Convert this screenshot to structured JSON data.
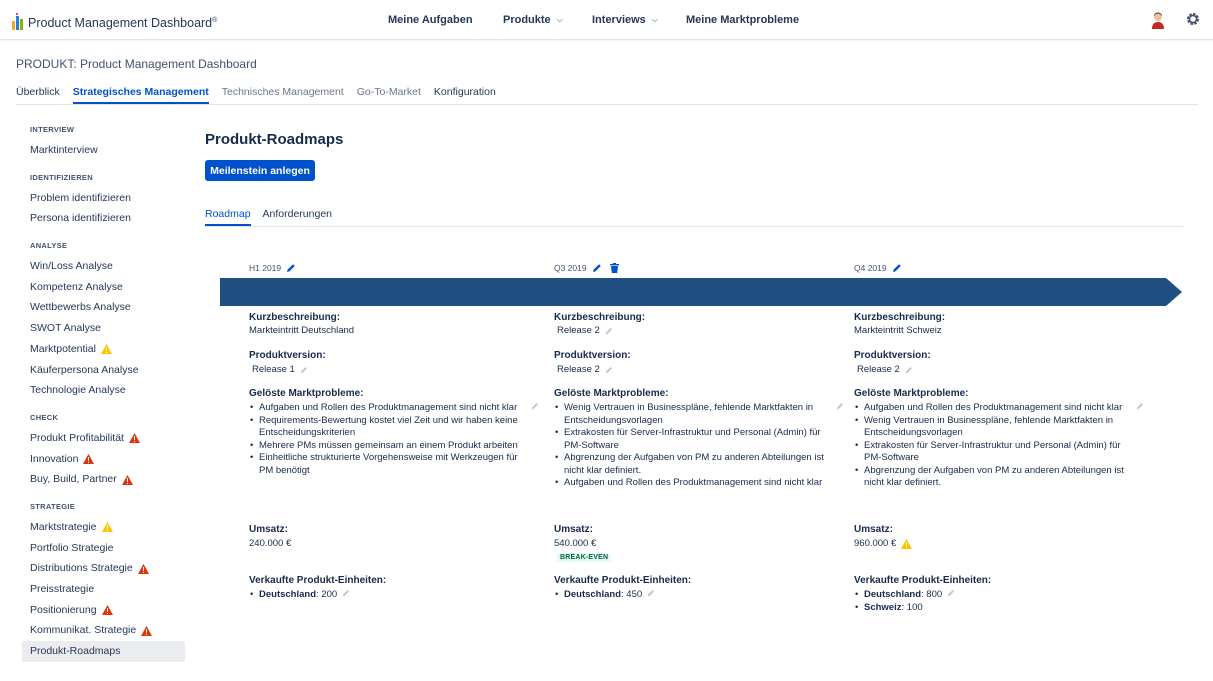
{
  "app": {
    "title": "Product Management Dashboard",
    "trademark": "®"
  },
  "topnav": [
    {
      "label": "Meine Aufgaben",
      "dropdown": false
    },
    {
      "label": "Produkte",
      "dropdown": true
    },
    {
      "label": "Interviews",
      "dropdown": true
    },
    {
      "label": "Meine Marktprobleme",
      "dropdown": false
    }
  ],
  "header": {
    "product_title": "PRODUKT: Product Management Dashboard",
    "tabs": [
      {
        "label": "Überblick",
        "state": "dark"
      },
      {
        "label": "Strategisches Management",
        "state": "active"
      },
      {
        "label": "Technisches Management",
        "state": "muted"
      },
      {
        "label": "Go-To-Market",
        "state": "muted"
      },
      {
        "label": "Konfiguration",
        "state": "dark"
      }
    ]
  },
  "sidebar": {
    "sections": [
      {
        "title": "INTERVIEW",
        "items": [
          {
            "label": "Marktinterview",
            "warning": null
          }
        ]
      },
      {
        "title": "IDENTIFIZIEREN",
        "items": [
          {
            "label": "Problem identifizieren",
            "warning": null
          },
          {
            "label": "Persona identifizieren",
            "warning": null
          }
        ]
      },
      {
        "title": "ANALYSE",
        "items": [
          {
            "label": "Win/Loss Analyse",
            "warning": null
          },
          {
            "label": "Kompetenz Analyse",
            "warning": null
          },
          {
            "label": "Wettbewerbs Analyse",
            "warning": null
          },
          {
            "label": "SWOT Analyse",
            "warning": null
          },
          {
            "label": "Marktpotential",
            "warning": "yellow"
          },
          {
            "label": "Käuferpersona Analyse",
            "warning": null
          },
          {
            "label": "Technologie Analyse",
            "warning": null
          }
        ]
      },
      {
        "title": "CHECK",
        "items": [
          {
            "label": "Produkt Profitabilität",
            "warning": "red"
          },
          {
            "label": "Innovation",
            "warning": "red"
          },
          {
            "label": "Buy, Build, Partner",
            "warning": "red"
          }
        ]
      },
      {
        "title": "STRATEGIE",
        "items": [
          {
            "label": "Marktstrategie",
            "warning": "yellow"
          },
          {
            "label": "Portfolio Strategie",
            "warning": null
          },
          {
            "label": "Distributions Strategie",
            "warning": "red"
          },
          {
            "label": "Preisstrategie",
            "warning": null
          },
          {
            "label": "Positionierung",
            "warning": "red"
          },
          {
            "label": "Kommunikat. Strategie",
            "warning": "red"
          },
          {
            "label": "Produkt-Roadmaps",
            "warning": null,
            "active": true
          }
        ]
      }
    ]
  },
  "main": {
    "title": "Produkt-Roadmaps",
    "primary_button": "Meilenstein anlegen",
    "subtabs": [
      {
        "label": "Roadmap",
        "active": true
      },
      {
        "label": "Anforderungen",
        "active": false
      }
    ],
    "labels": {
      "kurz": "Kurzbeschreibung:",
      "version": "Produktversion:",
      "probleme": "Gelöste Marktprobleme:",
      "umsatz": "Umsatz:",
      "einheiten": "Verkaufte Produkt-Einheiten:"
    },
    "milestones": [
      {
        "period": "H1 2019",
        "icons": [
          "pencil-icon"
        ],
        "kurzbeschreibung": "Markteintritt Deutschland",
        "kurz_editable": false,
        "produktversion": "Release 1",
        "probleme": [
          "Aufgaben und Rollen des Produktmanagement sind nicht klar",
          "Requirements-Bewertung kostet viel Zeit und wir haben keine Entscheidungskriterien",
          "Mehrere PMs müssen gemeinsam an einem Produkt arbeiten",
          "Einheitliche strukturierte Vorgehensweise mit Werkzeugen für PM benötigt"
        ],
        "umsatz": "240.000 €",
        "umsatz_badge": null,
        "umsatz_warning": null,
        "einheiten": [
          {
            "country": "Deutschland",
            "count": "200"
          }
        ]
      },
      {
        "period": "Q3 2019",
        "icons": [
          "pencil-icon",
          "trash-icon"
        ],
        "kurzbeschreibung": "Release 2",
        "kurz_editable": true,
        "produktversion": "Release 2",
        "probleme": [
          "Wenig Vertrauen in Businesspläne, fehlende Marktfakten in Entscheidungsvorlagen",
          "Extrakosten für Server-Infrastruktur und Personal (Admin) für PM-Software",
          "Abgrenzung der Aufgaben von PM zu anderen Abteilungen ist nicht klar definiert.",
          "Aufgaben und Rollen des Produktmanagement sind nicht klar"
        ],
        "umsatz": "540.000 €",
        "umsatz_badge": "BREAK-EVEN",
        "umsatz_warning": null,
        "einheiten": [
          {
            "country": "Deutschland",
            "count": "450"
          }
        ]
      },
      {
        "period": "Q4 2019",
        "icons": [
          "pencil-icon"
        ],
        "kurzbeschreibung": "Markteintritt Schweiz",
        "kurz_editable": false,
        "produktversion": "Release 2",
        "probleme": [
          "Aufgaben und Rollen des Produktmanagement sind nicht klar",
          "Wenig Vertrauen in Businesspläne, fehlende Marktfakten in Entscheidungsvorlagen",
          "Extrakosten für Server-Infrastruktur und Personal (Admin) für PM-Software",
          "Abgrenzung der Aufgaben von PM zu anderen Abteilungen ist nicht klar definiert."
        ],
        "umsatz": "960.000 €",
        "umsatz_badge": null,
        "umsatz_warning": "yellow",
        "einheiten": [
          {
            "country": "Deutschland",
            "count": "800"
          },
          {
            "country": "Schweiz",
            "count": "100"
          }
        ]
      }
    ]
  },
  "colors": {
    "primary": "#0052cc",
    "timeline": "#205081",
    "warning_yellow": "#ffc400",
    "warning_red": "#de350b",
    "break_even_bg": "#e3fcef",
    "break_even_text": "#006644"
  }
}
